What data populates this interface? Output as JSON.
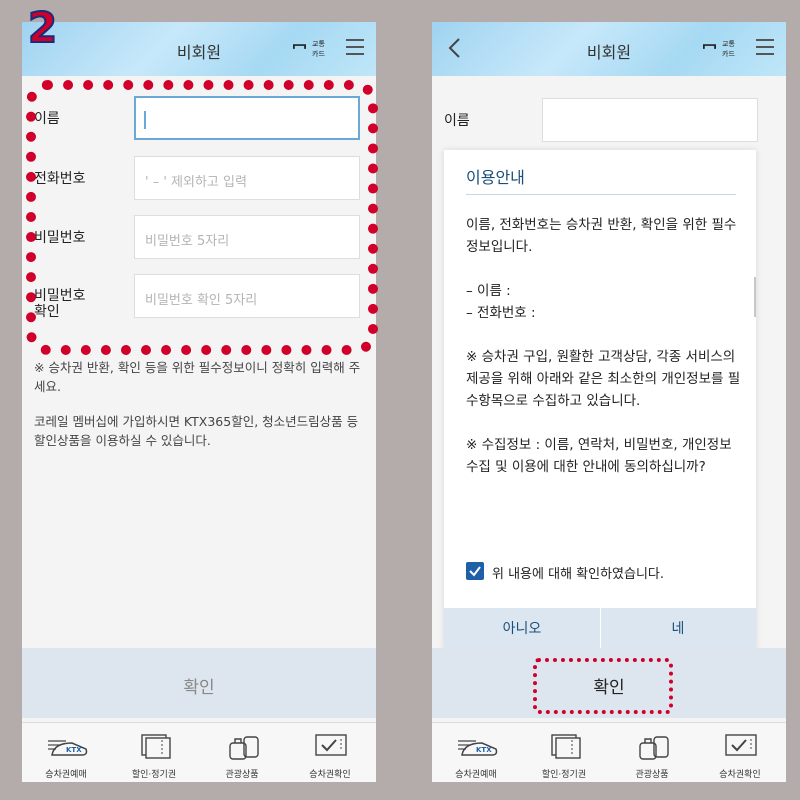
{
  "step_badge": "2",
  "left": {
    "header": {
      "title": "비회원",
      "card_label_1": "교통",
      "card_label_2": "카드"
    },
    "form": {
      "name_label": "이름",
      "phone_label": "전화번호",
      "phone_placeholder": "' – ' 제외하고 입력",
      "password_label": "비밀번호",
      "password_placeholder": "비밀번호 5자리",
      "password_confirm_label_1": "비밀번호",
      "password_confirm_label_2": "확인",
      "password_confirm_placeholder": "비밀번호 확인 5자리"
    },
    "notes": {
      "line1": "※ 승차권 반환, 확인 등을 위한 필수정보이니 정확히 입력해 주세요.",
      "line2": "코레일 멤버십에 가입하시면 KTX365할인, 청소년드림상품 등 할인상품을 이용하실 수 있습니다."
    },
    "confirm_label": "확인"
  },
  "right": {
    "header": {
      "title": "비회원",
      "card_label_1": "교통",
      "card_label_2": "카드"
    },
    "name_label": "이름",
    "modal": {
      "title": "이용안내",
      "p1": "이름, 전화번호는 승차권 반환, 확인을 위한 필수정보입니다.",
      "p2_line1": "– 이름 :",
      "p2_line2": "– 전화번호 :",
      "p3": "※ 승차권 구입, 원활한 고객상담, 각종 서비스의 제공을 위해 아래와 같은 최소한의 개인정보를 필수항목으로 수집하고 있습니다.",
      "p4": "※ 수집정보 : 이름, 연락처, 비밀번호, 개인정보 수집 및 이용에 대한 안내에 동의하십니까?",
      "checkbox_label": "위 내용에 대해 확인하였습니다.",
      "no_label": "아니오",
      "yes_label": "네"
    },
    "confirm_label": "확인"
  },
  "tabbar": {
    "items": [
      {
        "label": "승차권예매",
        "icon": "train-icon"
      },
      {
        "label": "할인·정기권",
        "icon": "tickets-icon"
      },
      {
        "label": "관광상품",
        "icon": "luggage-icon"
      },
      {
        "label": "승차권확인",
        "icon": "ticket-check-icon"
      }
    ]
  },
  "colors": {
    "header": "#a6d9f3",
    "accent": "#1e5fa8",
    "highlight": "#d0002a"
  }
}
